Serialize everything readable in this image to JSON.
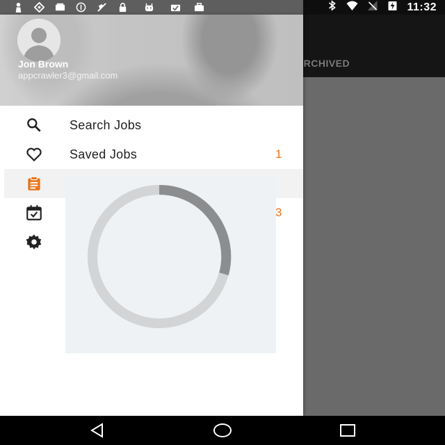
{
  "status_bar": {
    "time": "11:32",
    "left_icons": [
      "person-icon",
      "location-icon",
      "storage-icon",
      "info-icon",
      "silent-icon",
      "lock-icon",
      "android-icon",
      "briefcase-check-icon",
      "briefcase-icon"
    ],
    "right_icons": [
      "bluetooth-icon",
      "wifi-icon",
      "no-signal-icon",
      "battery-charging-icon"
    ]
  },
  "drawer": {
    "user": {
      "name": "Jon Brown",
      "email": "appcrawler3@gmail.com"
    },
    "items": [
      {
        "label": "Search Jobs",
        "icon": "search-icon",
        "count": ""
      },
      {
        "label": "Saved Jobs",
        "icon": "heart-icon",
        "count": "1"
      },
      {
        "label": "",
        "icon": "clipboard-icon",
        "count": ""
      },
      {
        "label": "",
        "icon": "calendar-check-icon",
        "count": "3"
      },
      {
        "label": "",
        "icon": "gear-icon",
        "count": ""
      }
    ]
  },
  "background_app": {
    "tab_label": "ARCHIVED"
  },
  "colors": {
    "accent": "#e8741c",
    "scrim": "#6a6a6a",
    "status_bar_dark": "#0e0e0e"
  },
  "loading": {
    "spinner": "circular-progress"
  },
  "nav_bar": {
    "buttons": [
      "back-icon",
      "home-icon",
      "recents-icon"
    ]
  }
}
